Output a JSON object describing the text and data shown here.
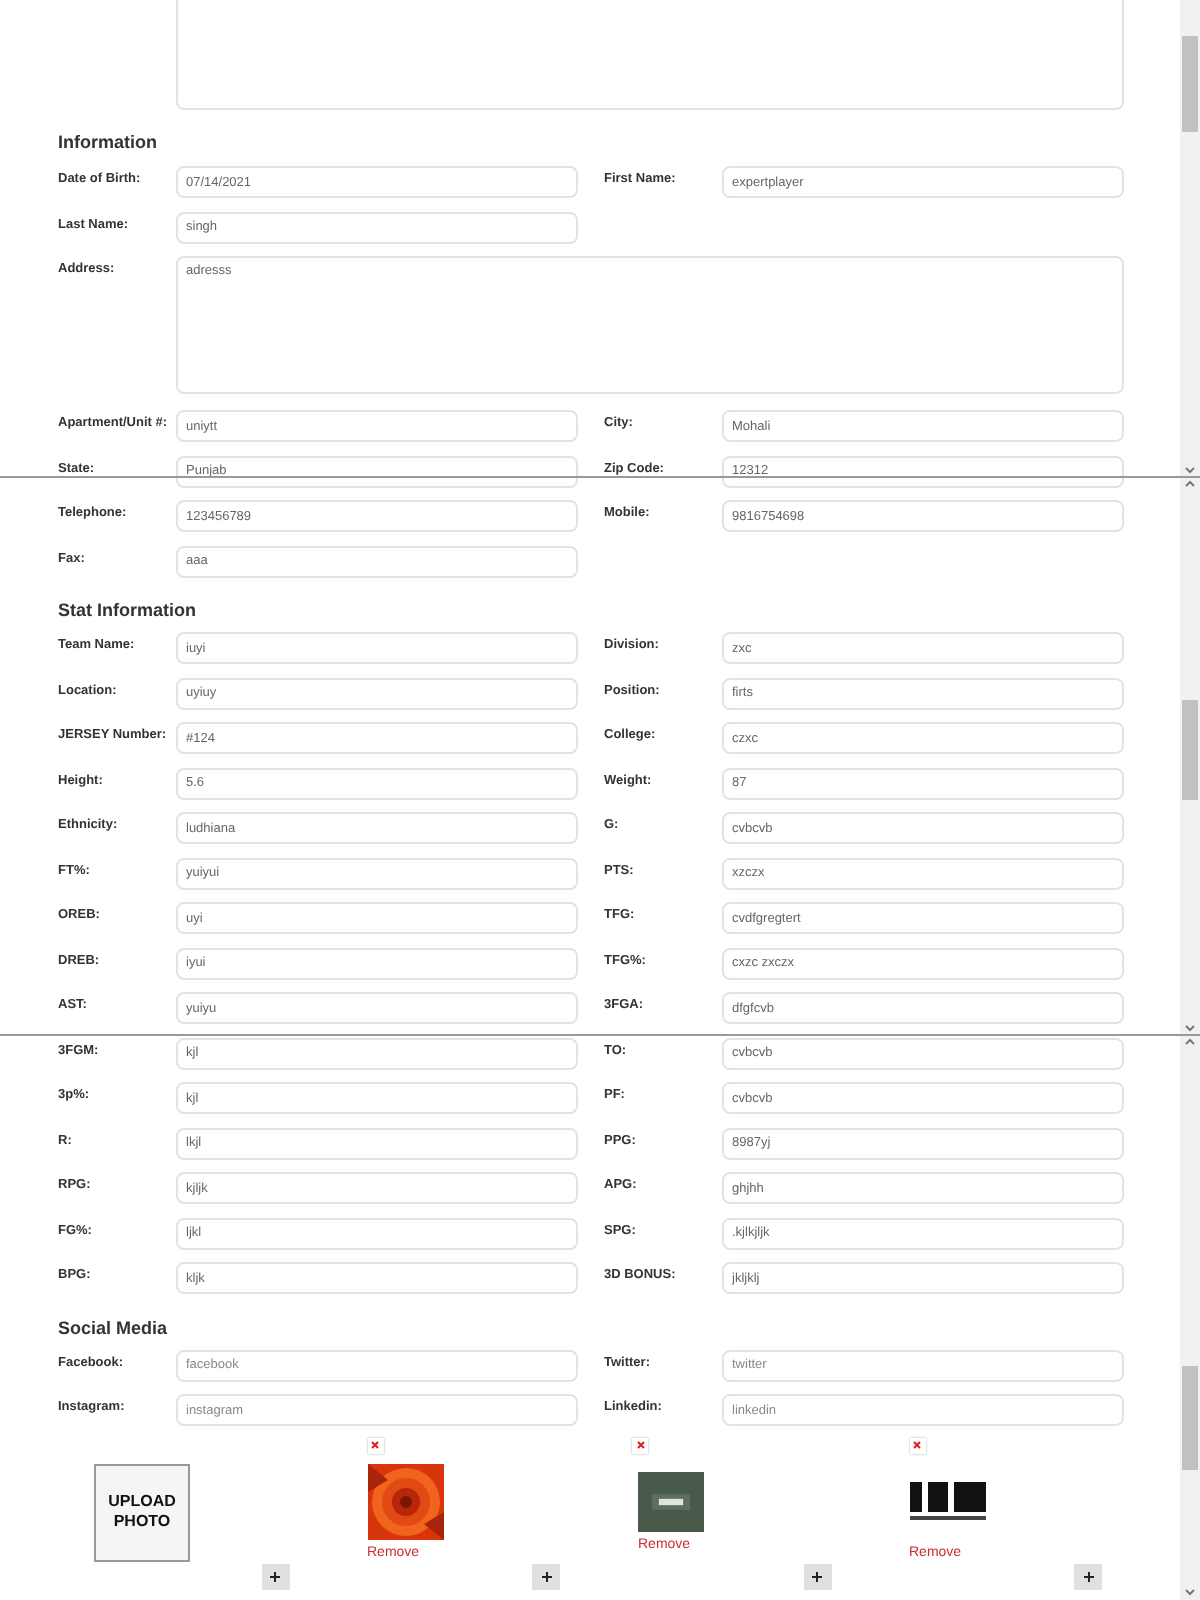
{
  "sections": [
    {
      "title": "Information",
      "rows": [
        {
          "fields": [
            {
              "label": "Date of Birth:",
              "value": "07/14/2021"
            },
            {
              "label": "First Name:",
              "value": "expertplayer"
            }
          ]
        },
        {
          "fields": [
            {
              "label": "Last Name:",
              "value": "singh"
            }
          ]
        },
        {
          "kind": "textarea",
          "fields": [
            {
              "label": "Address:",
              "value": "adresss"
            }
          ]
        },
        {
          "fields": [
            {
              "label": "Apartment/Unit #:",
              "value": "uniytt"
            },
            {
              "label": "City:",
              "value": "Mohali"
            }
          ]
        },
        {
          "fields": [
            {
              "label": "State:",
              "value": "Punjab"
            },
            {
              "label": "Zip Code:",
              "value": "12312"
            }
          ]
        },
        {
          "fields": [
            {
              "label": "Telephone:",
              "value": "123456789"
            },
            {
              "label": "Mobile:",
              "value": "9816754698"
            }
          ]
        },
        {
          "fields": [
            {
              "label": "Fax:",
              "value": "aaa"
            }
          ]
        }
      ]
    },
    {
      "title": "Stat Information",
      "rows": [
        {
          "fields": [
            {
              "label": "Team Name:",
              "value": "iuyi"
            },
            {
              "label": "Division:",
              "value": "zxc"
            }
          ]
        },
        {
          "fields": [
            {
              "label": "Location:",
              "value": "uyiuy"
            },
            {
              "label": "Position:",
              "value": "firts"
            }
          ]
        },
        {
          "fields": [
            {
              "label": "JERSEY Number:",
              "value": "#124"
            },
            {
              "label": "College:",
              "value": "czxc"
            }
          ]
        },
        {
          "fields": [
            {
              "label": "Height:",
              "value": "5.6"
            },
            {
              "label": "Weight:",
              "value": "87"
            }
          ]
        },
        {
          "fields": [
            {
              "label": "Ethnicity:",
              "value": "ludhiana"
            },
            {
              "label": "G:",
              "value": "cvbcvb"
            }
          ]
        },
        {
          "fields": [
            {
              "label": "FT%:",
              "value": "yuiyui"
            },
            {
              "label": "PTS:",
              "value": "xzczx"
            }
          ]
        },
        {
          "fields": [
            {
              "label": "OREB:",
              "value": "uyi"
            },
            {
              "label": "TFG:",
              "value": "cvdfgregtert"
            }
          ]
        },
        {
          "fields": [
            {
              "label": "DREB:",
              "value": "iyui"
            },
            {
              "label": "TFG%:",
              "value": "cxzc zxczx"
            }
          ]
        },
        {
          "fields": [
            {
              "label": "AST:",
              "value": "yuiyu"
            },
            {
              "label": "3FGA:",
              "value": "dfgfcvb"
            }
          ]
        },
        {
          "fields": [
            {
              "label": "3FGM:",
              "value": "kjl"
            },
            {
              "label": "TO:",
              "value": "cvbcvb"
            }
          ]
        },
        {
          "fields": [
            {
              "label": "3p%:",
              "value": "kjl"
            },
            {
              "label": "PF:",
              "value": "cvbcvb"
            }
          ]
        },
        {
          "fields": [
            {
              "label": "R:",
              "value": "lkjl"
            },
            {
              "label": "PPG:",
              "value": "8987yj"
            }
          ]
        },
        {
          "fields": [
            {
              "label": "RPG:",
              "value": "kjljk"
            },
            {
              "label": "APG:",
              "value": "ghjhh"
            }
          ]
        },
        {
          "fields": [
            {
              "label": "FG%:",
              "value": "ljkl"
            },
            {
              "label": "SPG:",
              "value": ".kjlkjljk"
            }
          ]
        },
        {
          "fields": [
            {
              "label": "BPG:",
              "value": "kljk"
            },
            {
              "label": "3D BONUS:",
              "value": "jkljklj"
            }
          ]
        }
      ]
    },
    {
      "title": "Social Media",
      "rows": [
        {
          "fields": [
            {
              "label": "Facebook:",
              "placeholder": "facebook"
            },
            {
              "label": "Twitter:",
              "placeholder": "twitter"
            }
          ]
        },
        {
          "fields": [
            {
              "label": "Instagram:",
              "placeholder": "instagram"
            },
            {
              "label": "Linkedin:",
              "placeholder": "linkedin"
            }
          ]
        }
      ]
    }
  ],
  "photos": [
    {
      "kind": "upload",
      "label": "UPLOAD PHOTO"
    },
    {
      "kind": "picture",
      "action": "Remove"
    },
    {
      "kind": "picture",
      "action": "Remove"
    },
    {
      "kind": "picture",
      "action": "Remove"
    }
  ]
}
